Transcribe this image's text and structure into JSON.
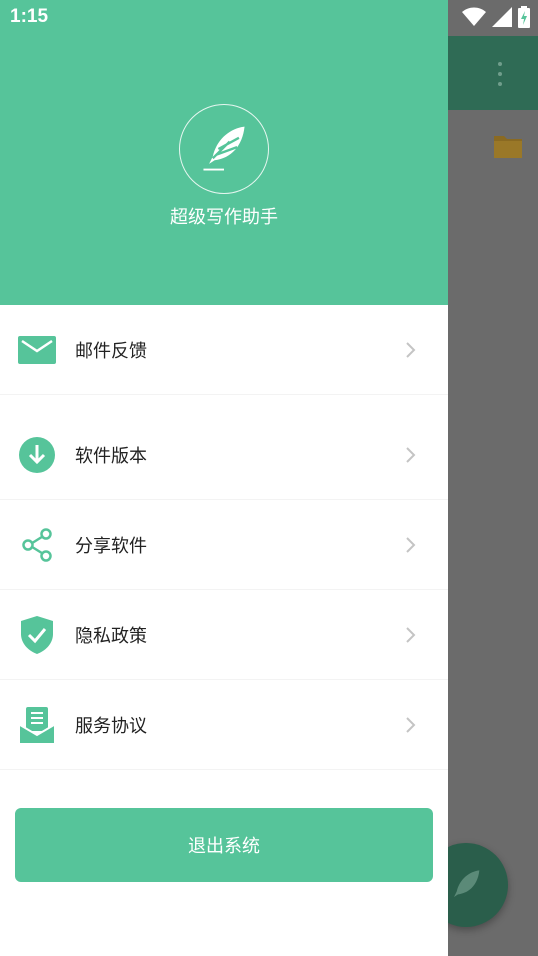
{
  "status_bar": {
    "time": "1:15"
  },
  "drawer": {
    "header": {
      "app_name": "超级写作助手",
      "logo_icon": "feather-icon"
    },
    "menu": [
      {
        "id": "feedback",
        "label": "邮件反馈",
        "icon": "mail-icon"
      },
      {
        "id": "version",
        "label": "软件版本",
        "icon": "download-icon"
      },
      {
        "id": "share",
        "label": "分享软件",
        "icon": "share-icon"
      },
      {
        "id": "privacy",
        "label": "隐私政策",
        "icon": "shield-check-icon"
      },
      {
        "id": "terms",
        "label": "服务协议",
        "icon": "agreement-icon"
      }
    ],
    "logout_label": "退出系统"
  },
  "colors": {
    "accent": "#56c49a",
    "toolbar_dim": "#2f6b55",
    "scrim": "#6b6b6b",
    "fab_dim": "#2a5e4b"
  }
}
